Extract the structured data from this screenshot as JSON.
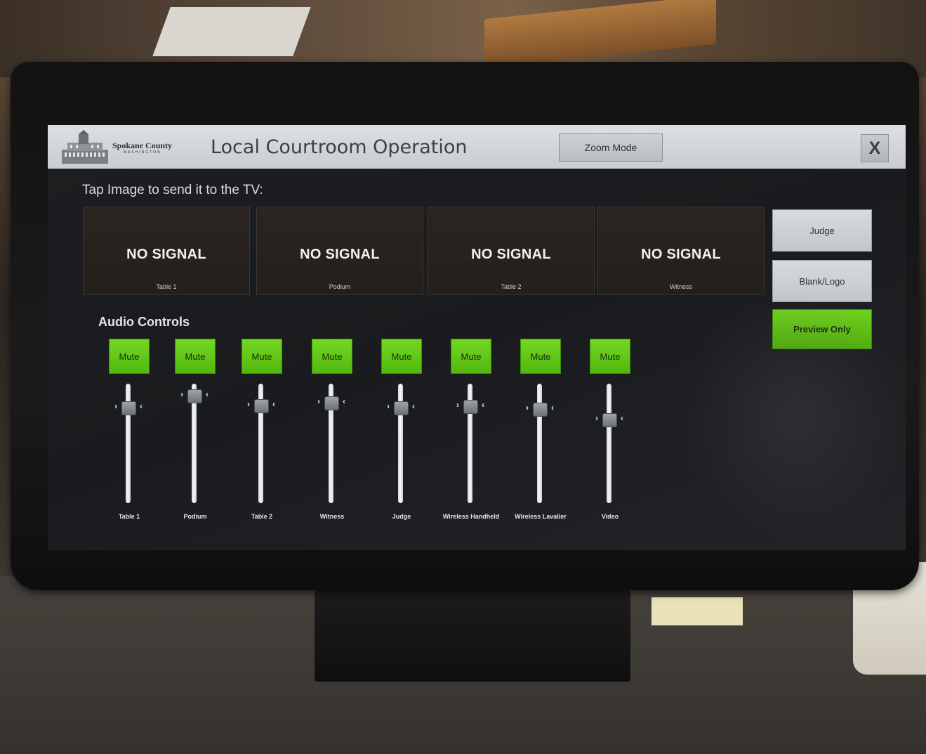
{
  "header": {
    "logo_name": "Spokane County",
    "logo_state": "WASHINGTON",
    "title": "Local Courtroom Operation",
    "zoom_button": "Zoom Mode",
    "close_button": "X"
  },
  "prompt": "Tap Image to send it to the TV:",
  "sources": [
    {
      "status": "NO SIGNAL",
      "label": "Table 1"
    },
    {
      "status": "NO SIGNAL",
      "label": "Podium"
    },
    {
      "status": "NO SIGNAL",
      "label": "Table 2"
    },
    {
      "status": "NO SIGNAL",
      "label": "Witness"
    }
  ],
  "side_buttons": {
    "judge": "Judge",
    "blank_logo": "Blank/Logo",
    "preview_only": "Preview Only"
  },
  "audio": {
    "title": "Audio Controls",
    "channels": [
      {
        "mute": "Mute",
        "label": "Table 1",
        "level": 0.8
      },
      {
        "mute": "Mute",
        "label": "Podium",
        "level": 0.9
      },
      {
        "mute": "Mute",
        "label": "Table 2",
        "level": 0.82
      },
      {
        "mute": "Mute",
        "label": "Witness",
        "level": 0.84
      },
      {
        "mute": "Mute",
        "label": "Judge",
        "level": 0.8
      },
      {
        "mute": "Mute",
        "label": "Wireless Handheld",
        "level": 0.81
      },
      {
        "mute": "Mute",
        "label": "Wireless Lavalier",
        "level": 0.79
      },
      {
        "mute": "Mute",
        "label": "Video",
        "level": 0.7
      }
    ]
  },
  "colors": {
    "mute_green": "#5fc415",
    "preview_green": "#62c516",
    "header_gray": "#d3d6da"
  }
}
